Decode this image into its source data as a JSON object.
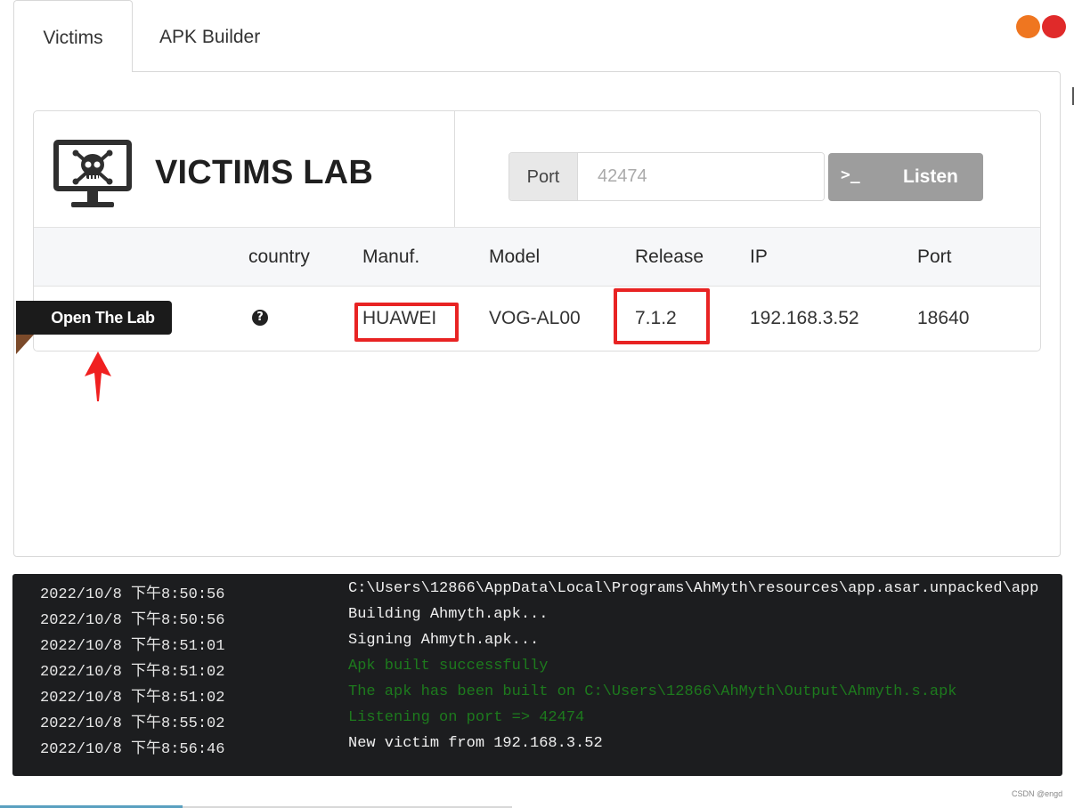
{
  "tabs": [
    {
      "label": "Victims",
      "active": true
    },
    {
      "label": "APK Builder",
      "active": false
    }
  ],
  "colors": {
    "accent_orange": "#ef7620",
    "accent_red": "#e02a2a",
    "highlight": "#e82323",
    "console_bg": "#1c1d1f",
    "log_green": "#1d7a1d"
  },
  "header": {
    "title": "VICTIMS LAB",
    "logo_icon": "monitor-skull-icon",
    "port_label": "Port",
    "port_placeholder": "42474",
    "listen_icon": "terminal-icon",
    "listen_glyph": ">_",
    "listen_label": "Listen"
  },
  "table": {
    "columns": [
      "country",
      "Manuf.",
      "Model",
      "Release",
      "IP",
      "Port"
    ],
    "rows": [
      {
        "open_label": "Open The Lab",
        "country_icon": "question-circle-icon",
        "country_glyph": "?",
        "manufacturer": "HUAWEI",
        "model": "VOG-AL00",
        "release": "7.1.2",
        "ip": "192.168.3.52",
        "port": "18640"
      }
    ]
  },
  "console": {
    "logs": [
      {
        "time": "2022/10/8 下午8:50:56",
        "message": "C:\\Users\\12866\\AppData\\Local\\Programs\\AhMyth\\resources\\app.asar.unpacked\\app",
        "color": "white"
      },
      {
        "time": "2022/10/8 下午8:50:56",
        "message": "Building Ahmyth.apk...",
        "color": "white"
      },
      {
        "time": "2022/10/8 下午8:51:01",
        "message": "Signing Ahmyth.apk...",
        "color": "white"
      },
      {
        "time": "2022/10/8 下午8:51:02",
        "message": "Apk built successfully",
        "color": "green"
      },
      {
        "time": "2022/10/8 下午8:51:02",
        "message": "The apk has been built on C:\\Users\\12866\\AhMyth\\Output\\Ahmyth.s.apk",
        "color": "green"
      },
      {
        "time": "2022/10/8 下午8:55:02",
        "message": "Listening on port => 42474",
        "color": "green"
      },
      {
        "time": "2022/10/8 下午8:56:46",
        "message": "New victim from 192.168.3.52",
        "color": "white"
      }
    ]
  },
  "watermark": "CSDN @engd"
}
